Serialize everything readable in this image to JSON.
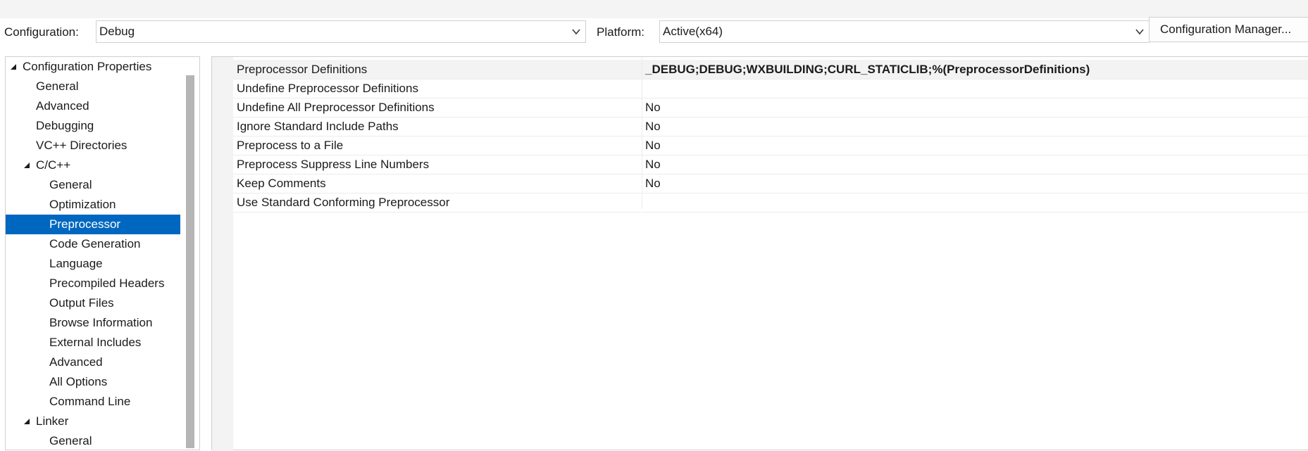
{
  "toolbar": {
    "configuration_label": "Configuration:",
    "configuration_value": "Debug",
    "platform_label": "Platform:",
    "platform_value": "Active(x64)",
    "config_manager_label": "Configuration Manager..."
  },
  "tree": {
    "items": [
      {
        "label": "Configuration Properties",
        "expanded": true
      },
      {
        "label": "General"
      },
      {
        "label": "Advanced"
      },
      {
        "label": "Debugging"
      },
      {
        "label": "VC++ Directories"
      },
      {
        "label": "C/C++",
        "expanded": true
      },
      {
        "label": "General"
      },
      {
        "label": "Optimization"
      },
      {
        "label": "Preprocessor",
        "selected": true
      },
      {
        "label": "Code Generation"
      },
      {
        "label": "Language"
      },
      {
        "label": "Precompiled Headers"
      },
      {
        "label": "Output Files"
      },
      {
        "label": "Browse Information"
      },
      {
        "label": "External Includes"
      },
      {
        "label": "Advanced"
      },
      {
        "label": "All Options"
      },
      {
        "label": "Command Line"
      },
      {
        "label": "Linker",
        "expanded": true
      },
      {
        "label": "General"
      }
    ]
  },
  "properties": {
    "rows": [
      {
        "name": "Preprocessor Definitions",
        "value": "_DEBUG;DEBUG;WXBUILDING;CURL_STATICLIB;%(PreprocessorDefinitions)"
      },
      {
        "name": "Undefine Preprocessor Definitions",
        "value": ""
      },
      {
        "name": "Undefine All Preprocessor Definitions",
        "value": "No"
      },
      {
        "name": "Ignore Standard Include Paths",
        "value": "No"
      },
      {
        "name": "Preprocess to a File",
        "value": "No"
      },
      {
        "name": "Preprocess Suppress Line Numbers",
        "value": "No"
      },
      {
        "name": "Keep Comments",
        "value": "No"
      },
      {
        "name": "Use Standard Conforming Preprocessor",
        "value": ""
      }
    ]
  },
  "colors": {
    "selection": "#0067c0",
    "gutter": "#f3f3f3",
    "scrollbar": "#b5b5b5"
  }
}
